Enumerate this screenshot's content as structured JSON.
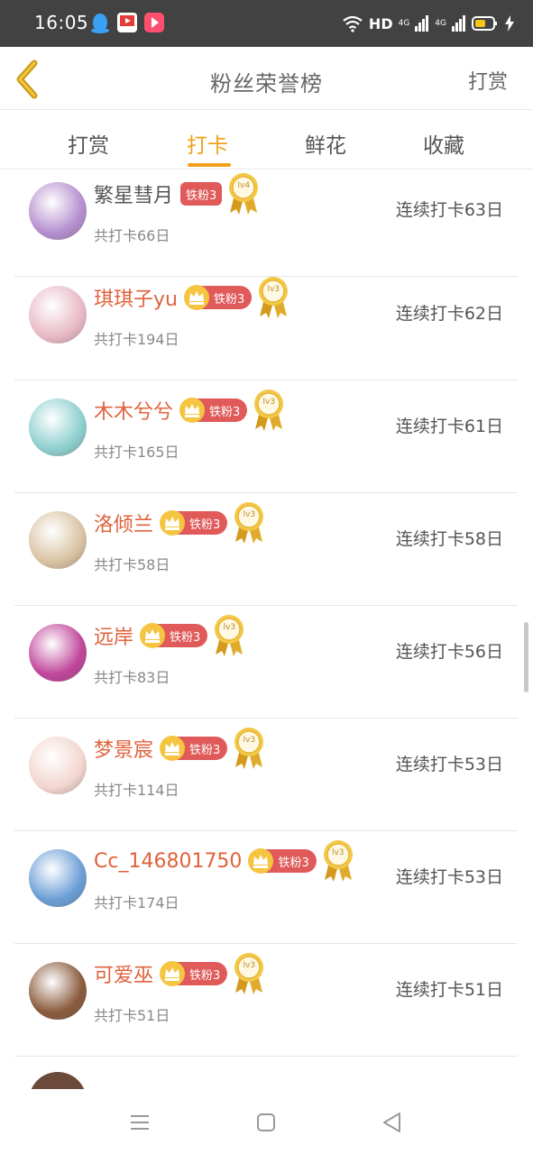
{
  "status_bar": {
    "time": "16:05",
    "network": "HD",
    "signal1": "4G",
    "signal2": "4G"
  },
  "header": {
    "title": "粉丝荣誉榜",
    "right_action": "打赏"
  },
  "tabs": [
    {
      "label": "打赏",
      "active": false
    },
    {
      "label": "打卡",
      "active": true
    },
    {
      "label": "鲜花",
      "active": false
    },
    {
      "label": "收藏",
      "active": false
    }
  ],
  "rows": [
    {
      "name": "繁星彗月",
      "highlight": false,
      "crown": false,
      "badge": "铁粉3",
      "level": "lv4",
      "total": "共打卡66日",
      "streak": "连续打卡63日",
      "avatar_color": "#b58fcf"
    },
    {
      "name": "琪琪子yu",
      "highlight": true,
      "crown": true,
      "badge": "铁粉3",
      "level": "lv3",
      "total": "共打卡194日",
      "streak": "连续打卡62日",
      "avatar_color": "#e8b9c6"
    },
    {
      "name": "木木兮兮",
      "highlight": true,
      "crown": true,
      "badge": "铁粉3",
      "level": "lv3",
      "total": "共打卡165日",
      "streak": "连续打卡61日",
      "avatar_color": "#8ecfcf"
    },
    {
      "name": "洛倾兰",
      "highlight": true,
      "crown": true,
      "badge": "铁粉3",
      "level": "lv3",
      "total": "共打卡58日",
      "streak": "连续打卡58日",
      "avatar_color": "#d9c3a3"
    },
    {
      "name": "远岸",
      "highlight": true,
      "crown": true,
      "badge": "铁粉3",
      "level": "lv3",
      "total": "共打卡83日",
      "streak": "连续打卡56日",
      "avatar_color": "#c0459a"
    },
    {
      "name": "梦景宸",
      "highlight": true,
      "crown": true,
      "badge": "铁粉3",
      "level": "lv3",
      "total": "共打卡114日",
      "streak": "连续打卡53日",
      "avatar_color": "#f3d6cf"
    },
    {
      "name": "Cc_146801750",
      "highlight": true,
      "crown": true,
      "badge": "铁粉3",
      "level": "lv3",
      "total": "共打卡174日",
      "streak": "连续打卡53日",
      "avatar_color": "#6b9ed6"
    },
    {
      "name": "可爱巫",
      "highlight": true,
      "crown": true,
      "badge": "铁粉3",
      "level": "lv3",
      "total": "共打卡51日",
      "streak": "连续打卡51日",
      "avatar_color": "#8a5a3c"
    }
  ],
  "colors": {
    "accent": "#f0a018",
    "badge": "#e05a5a",
    "name_highlight": "#e0623c"
  }
}
